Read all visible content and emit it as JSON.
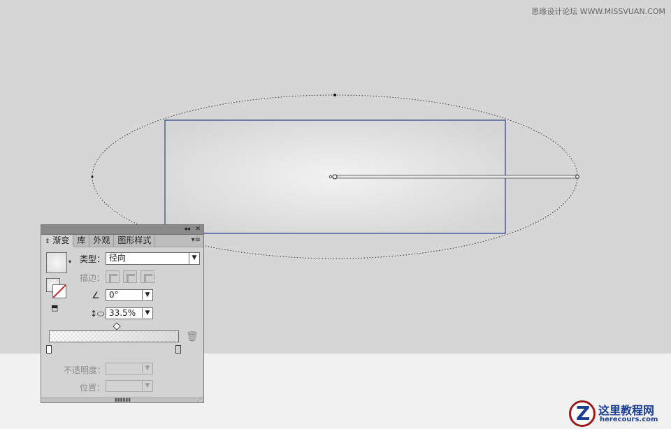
{
  "watermark_top": "思缘设计论坛 WWW.MISSVUAN.COM",
  "canvas": {
    "background_color": "#d6d6d6",
    "rect_fill_center": "#ececec",
    "rect_fill_edge": "#d9d9d9",
    "selection_color": "#2b3f8f"
  },
  "panel": {
    "tabs": [
      {
        "label": "渐变",
        "active": true
      },
      {
        "label": "库",
        "active": false
      },
      {
        "label": "外观",
        "active": false
      },
      {
        "label": "图形样式",
        "active": false
      }
    ],
    "type_label": "类型：",
    "type_value": "径向",
    "stroke_label": "描边：",
    "angle_value": "0°",
    "aspect_value": "33.5%",
    "opacity_label": "不透明度：",
    "position_label": "位置："
  },
  "logo": {
    "title": "这里教程网",
    "subtitle": "herecours.com"
  }
}
